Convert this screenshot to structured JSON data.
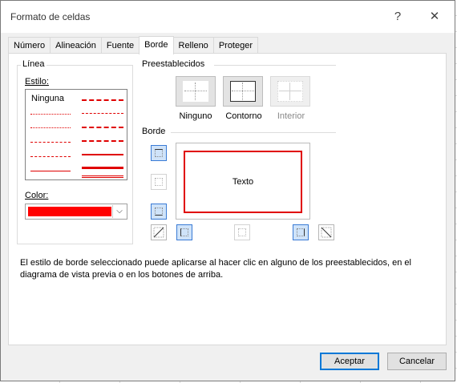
{
  "dialog": {
    "title": "Formato de celdas",
    "help_btn": "?",
    "close_btn": "✕"
  },
  "tabs": [
    {
      "label": "Número"
    },
    {
      "label": "Alineación"
    },
    {
      "label": "Fuente"
    },
    {
      "label": "Borde",
      "active": true
    },
    {
      "label": "Relleno"
    },
    {
      "label": "Proteger"
    }
  ],
  "line_group": {
    "title": "Línea",
    "style_label": "Estilo:",
    "none_label": "Ninguna",
    "color_label": "Color:",
    "color_value": "#ff0000"
  },
  "presets": {
    "title": "Preestablecidos",
    "items": [
      {
        "label": "Ninguno"
      },
      {
        "label": "Contorno"
      },
      {
        "label": "Interior"
      }
    ]
  },
  "border": {
    "title": "Borde",
    "preview_text": "Texto"
  },
  "help_text": "El estilo de borde seleccionado puede aplicarse al hacer clic en alguno de los preestablecidos, en el diagrama de vista previa o en los botones de arriba.",
  "buttons": {
    "accept": "Aceptar",
    "cancel": "Cancelar"
  }
}
